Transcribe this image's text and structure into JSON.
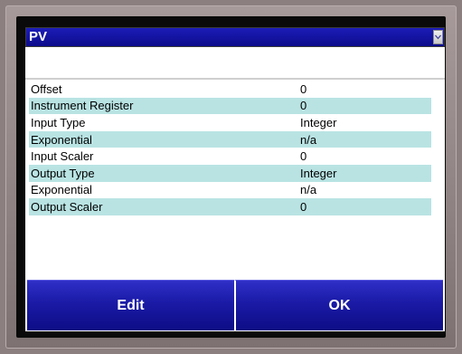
{
  "selector": {
    "value": "PV"
  },
  "table": {
    "rows": [
      {
        "label": "Offset",
        "value": "0"
      },
      {
        "label": "Instrument Register",
        "value": "0"
      },
      {
        "label": "Input Type",
        "value": "Integer"
      },
      {
        "label": "Exponential",
        "value": "n/a"
      },
      {
        "label": "Input Scaler",
        "value": "0"
      },
      {
        "label": "Output Type",
        "value": "Integer"
      },
      {
        "label": "Exponential",
        "value": "n/a"
      },
      {
        "label": "Output Scaler",
        "value": "0"
      }
    ]
  },
  "buttons": {
    "edit_label": "Edit",
    "ok_label": "OK"
  },
  "colors": {
    "frame": "#8c7f7f",
    "header_blue": "#0c0c8c",
    "row_highlight": "#b9e3e3",
    "button_blue": "#1a1aa6"
  }
}
